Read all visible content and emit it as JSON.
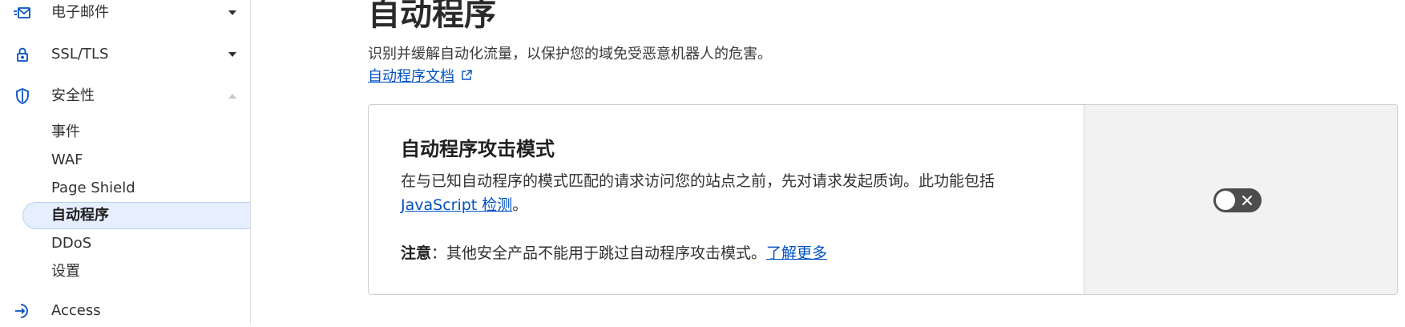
{
  "sidebar": {
    "items": [
      {
        "label": "电子邮件",
        "icon": "email-routing-icon",
        "caret": "chevron-down"
      },
      {
        "label": "SSL/TLS",
        "icon": "lock-icon",
        "caret": "chevron-down"
      },
      {
        "label": "安全性",
        "icon": "shield-icon",
        "caret": "chevron-up"
      }
    ],
    "security_subitems": [
      "事件",
      "WAF",
      "Page Shield",
      "自动程序",
      "DDoS",
      "设置"
    ],
    "active_subitem": "自动程序",
    "access": {
      "label": "Access",
      "icon": "access-icon"
    }
  },
  "main": {
    "title": "自动程序",
    "description": "识别并缓解自动化流量，以保护您的域免受恶意机器人的危害。",
    "doc_link": "自动程序文档",
    "card": {
      "title": "自动程序攻击模式",
      "desc_prefix": "在与已知自动程序的模式匹配的请求访问您的站点之前，先对请求发起质询。此功能包括",
      "desc_link": "JavaScript 检测",
      "desc_suffix": "。",
      "note_label": "注意",
      "note_text": "：其他安全产品不能用于跳过自动程序攻击模式。",
      "note_link": "了解更多",
      "toggle_state": "off"
    }
  },
  "colors": {
    "link": "#0051c3",
    "active_bg": "#e6efff",
    "toggle_off": "#4d4d4d",
    "side_panel_bg": "#f2f2f2"
  }
}
